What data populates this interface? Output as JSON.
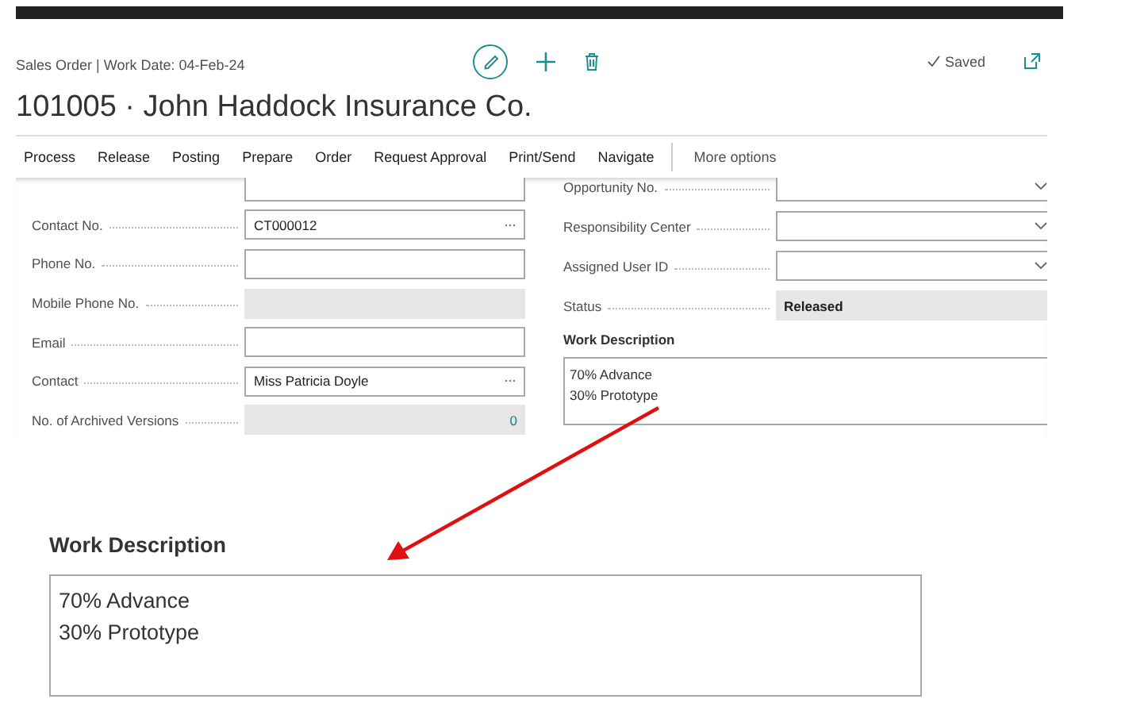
{
  "header": {
    "breadcrumb": "Sales Order | Work Date: 04-Feb-24",
    "title": "101005 · John Haddock Insurance Co.",
    "status": "Saved"
  },
  "actions": [
    {
      "label": "Process"
    },
    {
      "label": "Release"
    },
    {
      "label": "Posting"
    },
    {
      "label": "Prepare"
    },
    {
      "label": "Order"
    },
    {
      "label": "Request Approval"
    },
    {
      "label": "Print/Send"
    },
    {
      "label": "Navigate"
    }
  ],
  "more_options": "More options",
  "left_fields": [
    {
      "kind": "text"
    },
    {
      "label": "Contact No.",
      "kind": "lookup",
      "value": "CT000012"
    },
    {
      "label": "Phone No.",
      "kind": "text"
    },
    {
      "label": "Mobile Phone No.",
      "kind": "readonly"
    },
    {
      "label": "Email",
      "kind": "text"
    },
    {
      "label": "Contact",
      "kind": "lookup",
      "value": "Miss Patricia Doyle"
    },
    {
      "label": "No. of Archived Versions",
      "kind": "number",
      "value": "0"
    }
  ],
  "right_fields": [
    {
      "label": "Opportunity No.",
      "kind": "dropdown"
    },
    {
      "label": "Responsibility Center",
      "kind": "dropdown"
    },
    {
      "label": "Assigned User ID",
      "kind": "dropdown"
    },
    {
      "label": "Status",
      "kind": "readonly",
      "value": "Released"
    }
  ],
  "work_description": {
    "label": "Work Description",
    "lines": [
      "70% Advance",
      "30% Prototype"
    ]
  },
  "zoomed_work_description": {
    "label": "Work Description",
    "lines": [
      "70% Advance",
      "30% Prototype"
    ]
  }
}
